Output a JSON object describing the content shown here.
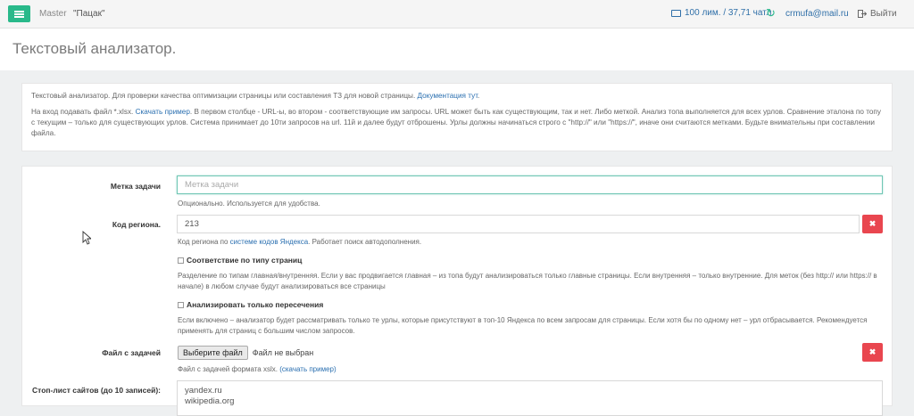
{
  "topbar": {
    "brand": "Master",
    "project": "\"Пацак\"",
    "limits": "100 лим. / 37,71 чатл.",
    "email": "crmufa@mail.ru",
    "logout": "Выйти"
  },
  "page": {
    "title": "Текстовый анализатор."
  },
  "info": {
    "line1": "Текстовый анализатор. Для проверки качества оптимизации страницы или составления ТЗ для новой страницы.",
    "doc_link": "Документация тут",
    "line2_start": "На вход подавать файл *.xlsx.",
    "sample_link": "Скачать пример",
    "line2_rest": ". В первом столбце - URL-ы, во втором - соответствующие им запросы. URL может быть как существующим, так и нет. Либо меткой. Анализ топа выполняется для всех урлов. Сравнение эталона по топу с текущим – только для существующих урлов. Система принимает до 10ти запросов на url. 11й и далее будут отброшены. Урлы должны начинаться строго с \"http://\" или \"https://\", иначе они считаются метками. Будьте внимательны при составлении файла."
  },
  "form": {
    "task_label": "Метка задачи",
    "task_placeholder": "Метка задачи",
    "task_help": "Опционально. Используется для удобства.",
    "region_label": "Код региона.",
    "region_value": "213",
    "region_help_start": "Код региона по",
    "region_help_link": "системе кодов Яндекса",
    "region_help_end": ". Работает поиск автодополнения.",
    "pagetype_label": "Соответствие по типу страниц",
    "pagetype_help": "Разделение по типам главная/внутренняя. Если у вас продвигается главная – из топа будут анализироваться только главные страницы. Если внутренняя – только внутренние. Для меток (без http:// или https:// в начале) в любом случае будут анализироваться все страницы",
    "intersect_label": "Анализировать только пересечения",
    "intersect_help": "Если включено – анализатор будет рассматривать только те урлы, которые присутствуют в топ-10 Яндекса по всем запросам для страницы. Если хотя бы по одному нет – урл отбрасывается. Рекомендуется применять для страниц с большим числом запросов.",
    "file_label": "Файл с задачей",
    "file_button": "Выберите файл",
    "file_status": "Файл не выбран",
    "file_help_start": "Файл с задачей формата xslx.",
    "file_help_link": "(скачать пример)",
    "stoplist_label": "Стоп-лист сайтов (до 10 записей):",
    "stoplist_lines": [
      "yandex.ru",
      "wikipedia.org"
    ],
    "clear_symbol": "✖"
  },
  "icons": {
    "menu": "menu-icon",
    "limits": "credit-card-icon",
    "refresh": "refresh-icon",
    "logout": "logout-icon",
    "clear": "close-icon",
    "cursor": "mouse-cursor-icon"
  },
  "colors": {
    "accent": "#29b98a",
    "link": "#2a6fb0",
    "danger": "#e9464f"
  }
}
